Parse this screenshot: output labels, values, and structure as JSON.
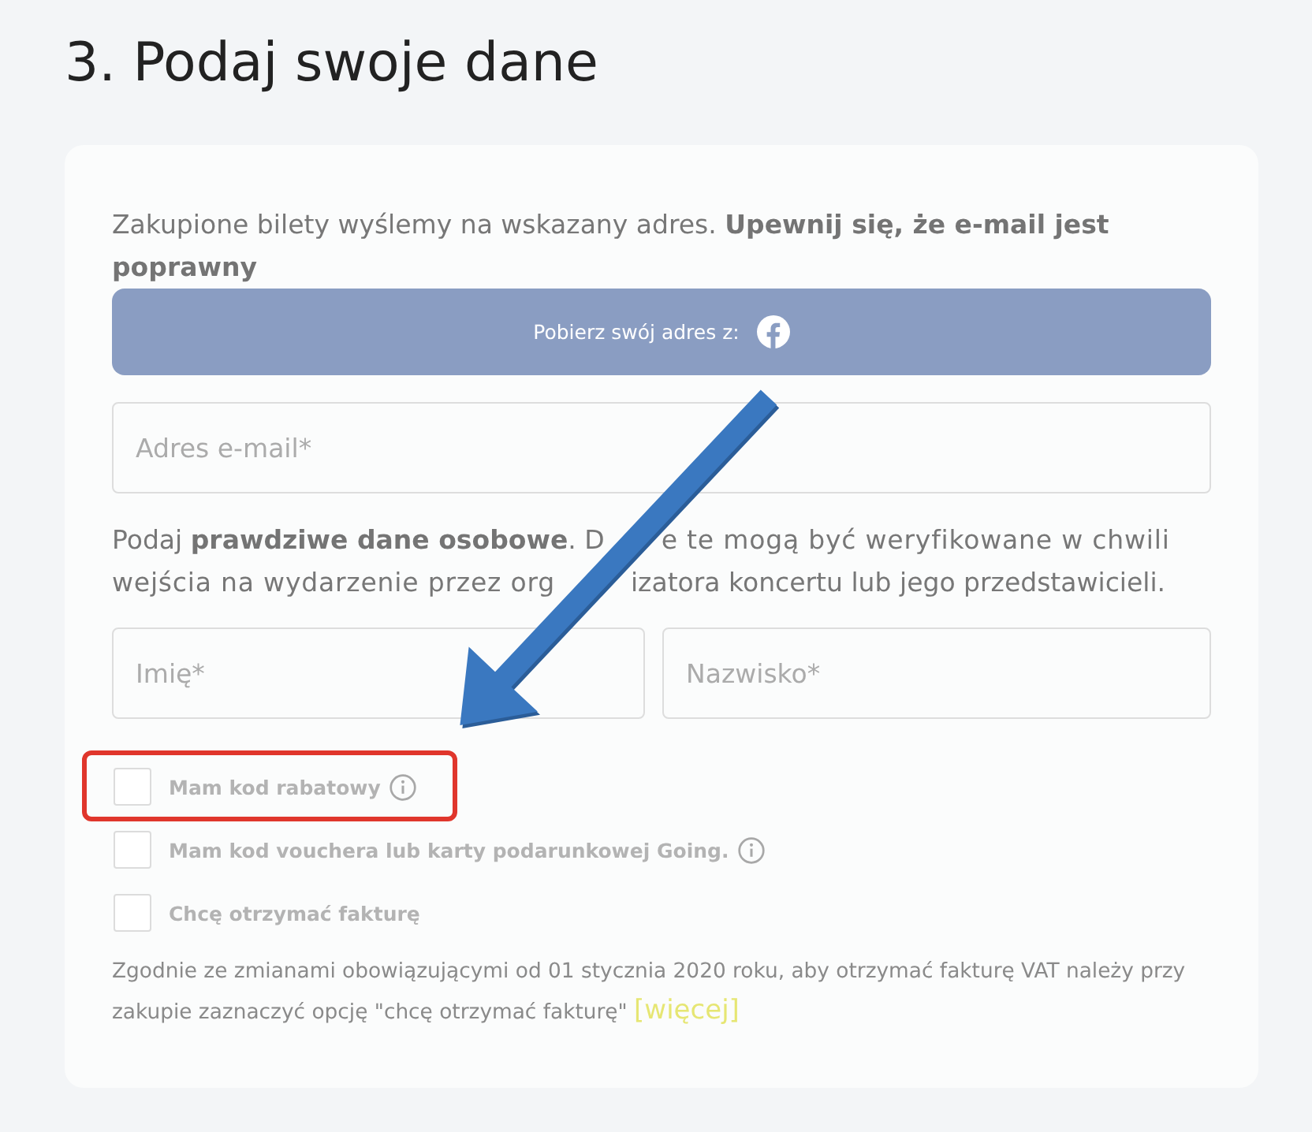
{
  "heading": "3. Podaj swoje dane",
  "form": {
    "intro": "Zakupione bilety wyślemy na wskazany adres. **Upewnij się, że e-mail jest poprawny**",
    "facebook_button": {
      "label": "Pobierz swój adres z:"
    },
    "email_field": {
      "placeholder": "Adres e-mail*"
    },
    "personal_note": [
      "Podaj **prawdziwe dane osobowe**. D",
      "e te mogą być weryfikowane w chwili wejścia na wydarzenie przez org",
      "izatora koncertu lub jego przedstawicieli."
    ],
    "name_fields": [
      {
        "placeholder": "Imię*"
      },
      {
        "placeholder": "Nazwisko*"
      }
    ],
    "options": [
      {
        "label": "Mam kod rabatowy",
        "checked": false,
        "info": true,
        "highlighted": true
      },
      {
        "label": "Mam kod vouchera lub karty podarunkowej Going.",
        "checked": false,
        "info": true,
        "highlighted": false
      },
      {
        "label": "Chcę otrzymać fakturę",
        "checked": false,
        "info": false,
        "highlighted": false
      }
    ],
    "invoice_note": {
      "text": "Zgodnie ze zmianami obowiązującymi od 01 stycznia 2020 roku, aby otrzymać fakturę VAT należy przy zakupie zaznaczyć opcję \"chcę otrzymać fakturę\"",
      "link": "[więcej]"
    }
  },
  "annotations": [
    {
      "kind": "arrow"
    }
  ]
}
